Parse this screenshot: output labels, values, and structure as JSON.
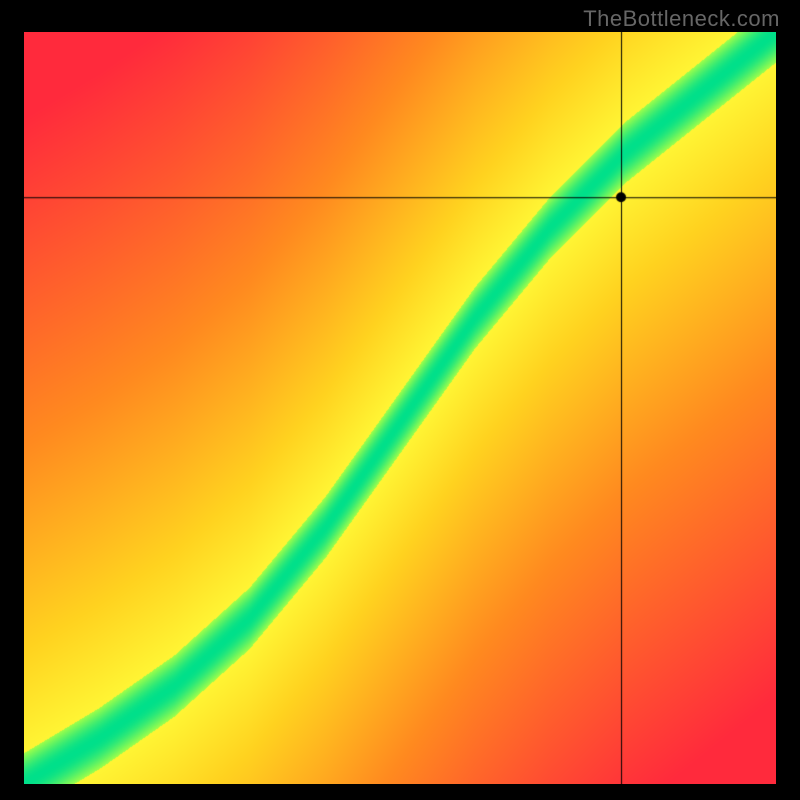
{
  "watermark": "TheBottleneck.com",
  "chart_data": {
    "type": "heatmap",
    "title": "",
    "xlabel": "",
    "ylabel": "",
    "xlim": [
      0,
      1
    ],
    "ylim": [
      0,
      1
    ],
    "grid": false,
    "crosshair": {
      "x": 0.795,
      "y": 0.78
    },
    "marker": {
      "x": 0.795,
      "y": 0.78
    },
    "colormap": {
      "stops": [
        {
          "value": 0.0,
          "color": "#ff2a3c"
        },
        {
          "value": 0.35,
          "color": "#ff8a1f"
        },
        {
          "value": 0.55,
          "color": "#ffd21f"
        },
        {
          "value": 0.75,
          "color": "#ffff3a"
        },
        {
          "value": 0.9,
          "color": "#9eff4a"
        },
        {
          "value": 1.0,
          "color": "#00e08a"
        }
      ]
    },
    "ideal_curve": {
      "description": "Green ridge where CPU and GPU are balanced; S-shaped from origin to top-right.",
      "points": [
        {
          "x": 0.0,
          "y": 0.0
        },
        {
          "x": 0.1,
          "y": 0.06
        },
        {
          "x": 0.2,
          "y": 0.13
        },
        {
          "x": 0.3,
          "y": 0.22
        },
        {
          "x": 0.4,
          "y": 0.34
        },
        {
          "x": 0.5,
          "y": 0.48
        },
        {
          "x": 0.6,
          "y": 0.62
        },
        {
          "x": 0.7,
          "y": 0.74
        },
        {
          "x": 0.8,
          "y": 0.84
        },
        {
          "x": 0.9,
          "y": 0.92
        },
        {
          "x": 1.0,
          "y": 1.0
        }
      ],
      "band_width": 0.06
    }
  }
}
